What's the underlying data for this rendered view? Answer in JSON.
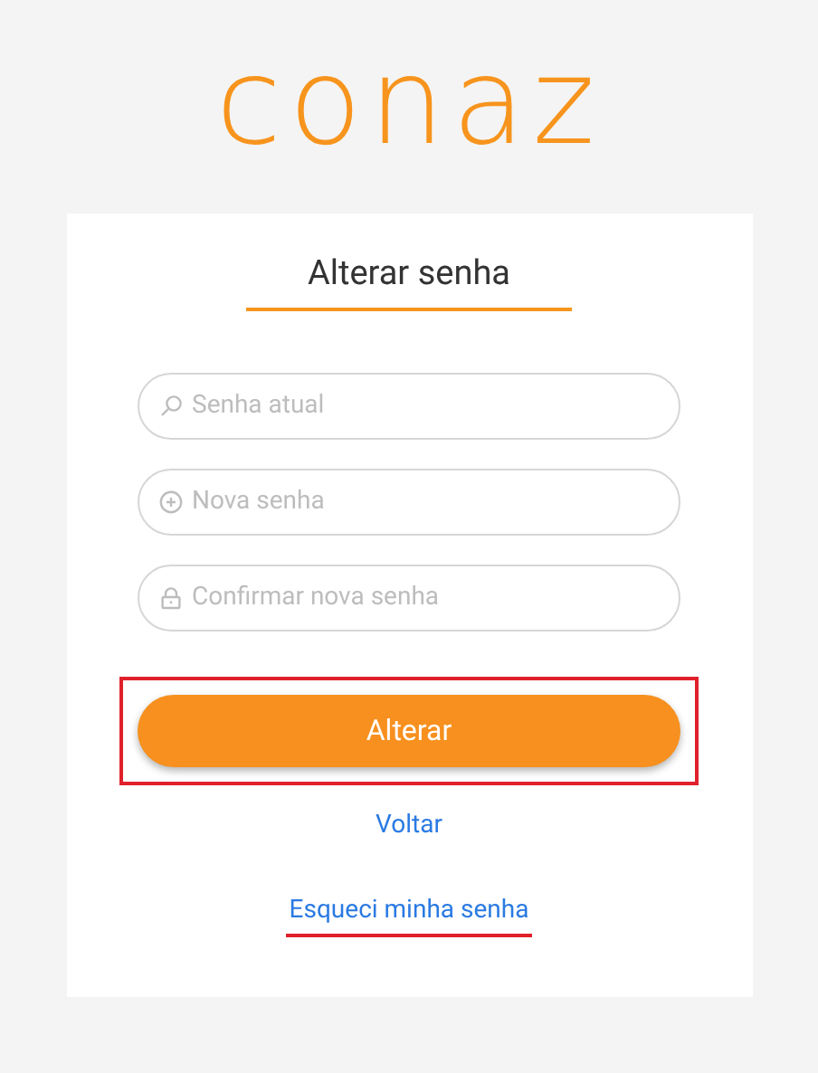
{
  "logo": {
    "text": "conaz"
  },
  "form": {
    "title": "Alterar senha",
    "fields": [
      {
        "kind": "key",
        "placeholder": "Senha atual"
      },
      {
        "kind": "plus",
        "placeholder": "Nova senha"
      },
      {
        "kind": "lock",
        "placeholder": "Confirmar nova senha"
      }
    ],
    "submit": {
      "label": "Alterar",
      "highlighted": true
    },
    "links": [
      {
        "label": "Voltar",
        "highlighted": false
      },
      {
        "label": "Esqueci minha senha",
        "highlighted": true
      }
    ]
  }
}
